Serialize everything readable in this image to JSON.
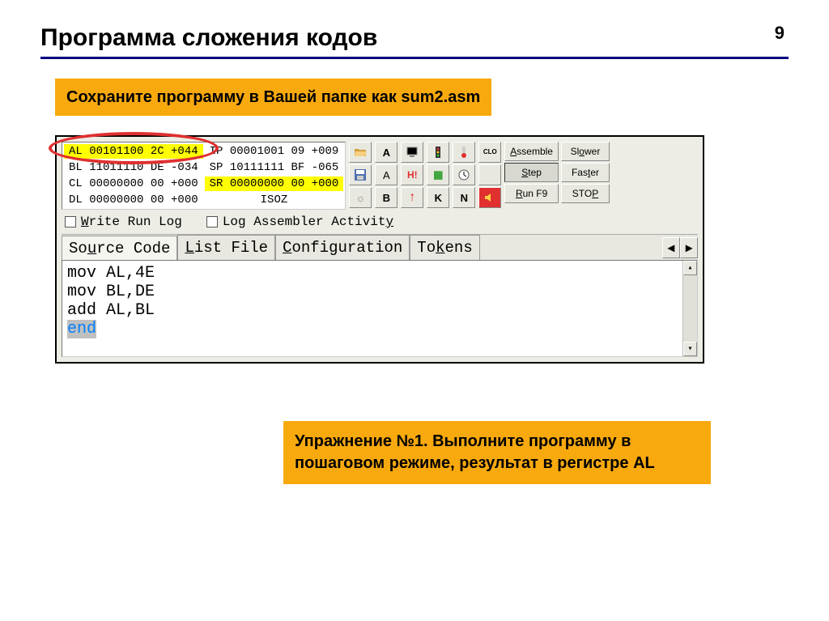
{
  "page_number": "9",
  "title": "Программа сложения кодов",
  "instruction": "Сохраните программу в Вашей папке как sum2.asm",
  "exercise": "Упражнение №1. Выполните программу в пошаговом режиме, результат в регистре AL",
  "registers": {
    "AL": "AL 00101100 2C +044",
    "BL": "BL 11011110 DE -034",
    "CL": "CL 00000000 00 +000",
    "DL": "DL 00000000 00 +000",
    "IP": "IP 00001001 09 +009",
    "SP": "SP 10111111 BF -065",
    "SR": "SR 00000000 00 +000",
    "flags": "ISOZ"
  },
  "icons": {
    "open": "📂",
    "save": "💾",
    "sun": "☼",
    "A1": "A",
    "A2": "A",
    "B": "B",
    "monitor": "🖵",
    "H": "H!",
    "uparrow": "↑",
    "traffic": "🚦",
    "grid": "▦",
    "K": "K",
    "thermo": "🌡",
    "clock": "⏲",
    "N": "N",
    "clo": "CLO",
    "speaker": "🔊"
  },
  "buttons": {
    "assemble": "Assemble",
    "step": "Step",
    "run": "Run F9",
    "slower": "Slower",
    "faster": "Faster",
    "stop": "STOP"
  },
  "checkboxes": {
    "write_log": "Write Run Log",
    "log_asm": "Log Assembler Activity"
  },
  "tabs": {
    "source": "Source Code",
    "list": "List File",
    "config": "Configuration",
    "tokens": "Tokens"
  },
  "code": {
    "l1": "mov AL,4E",
    "l2": "mov BL,DE",
    "l3": "add AL,BL",
    "l4": "end"
  }
}
